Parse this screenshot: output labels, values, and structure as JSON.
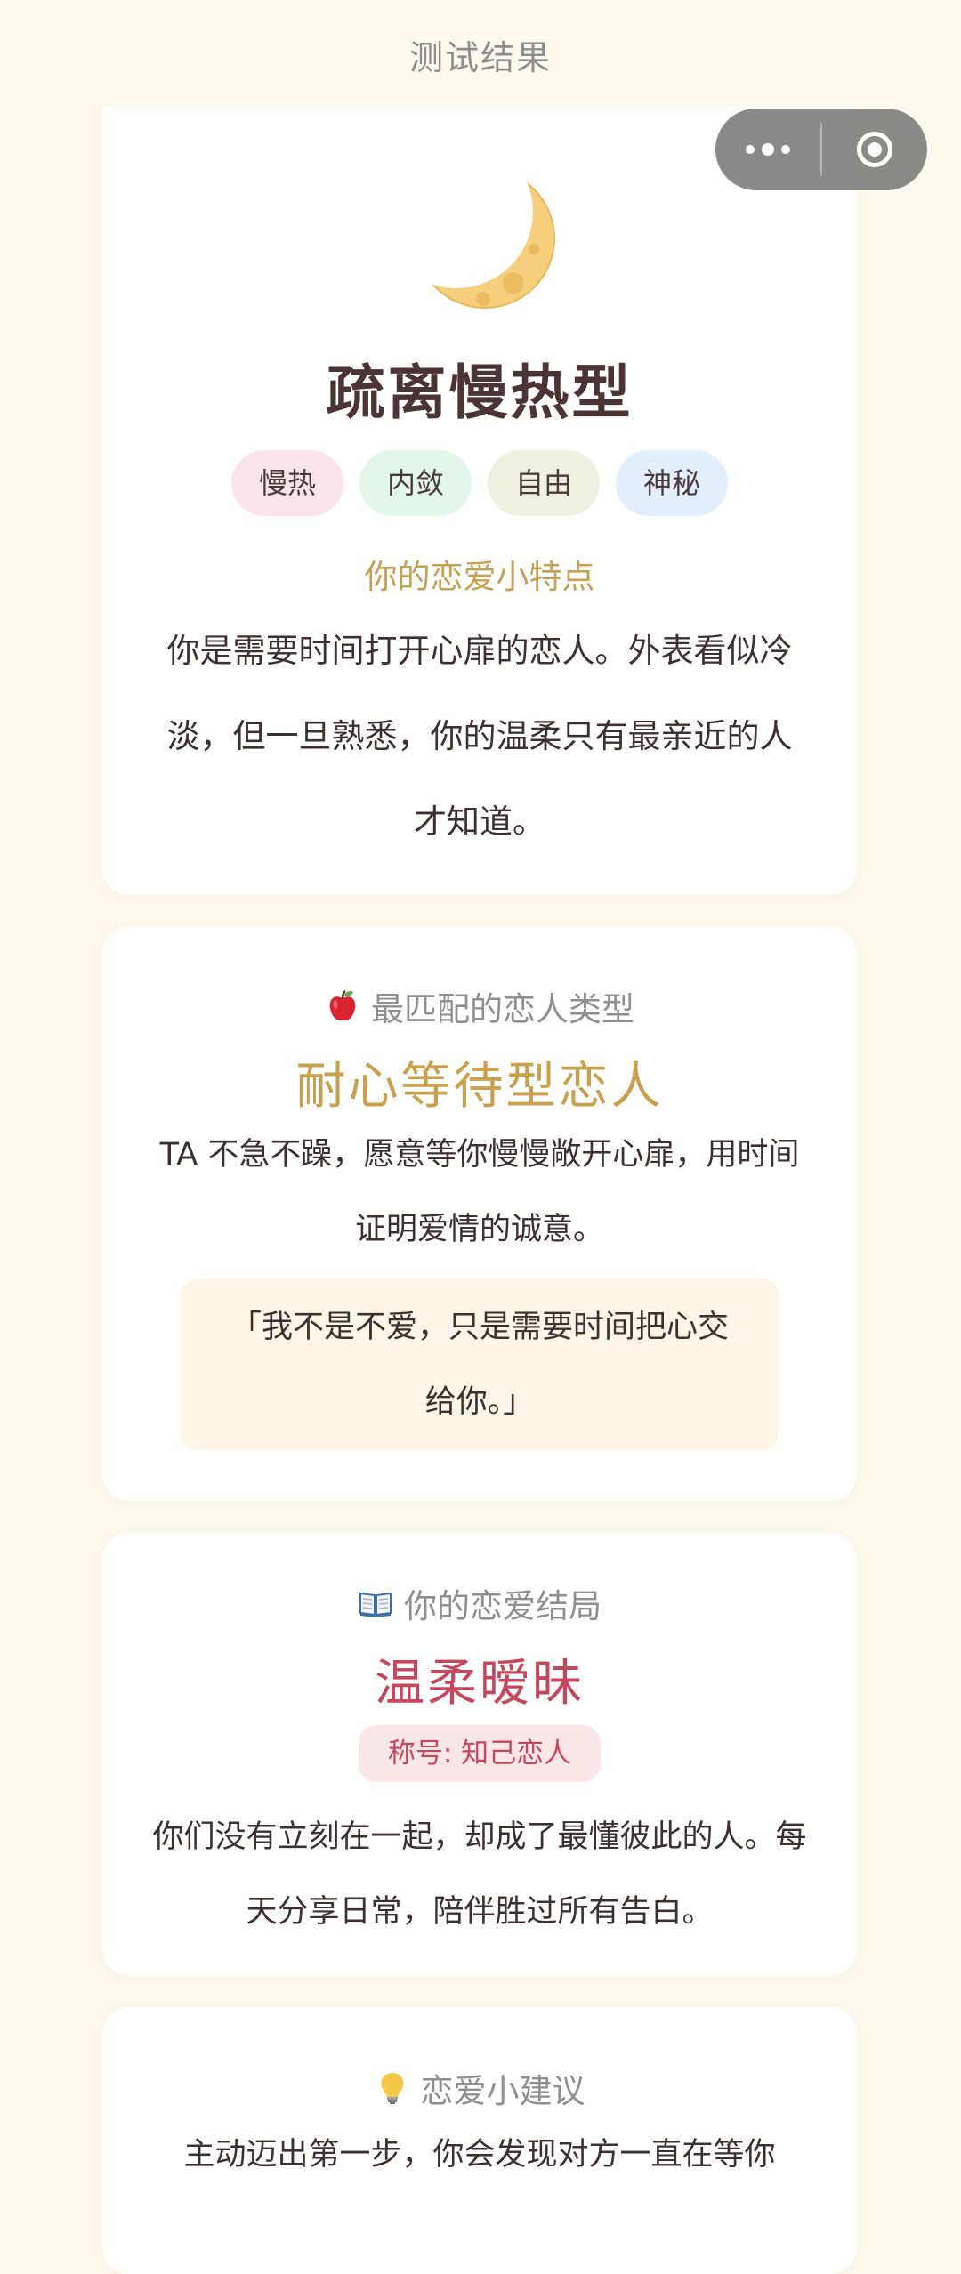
{
  "header": {
    "title": "测试结果"
  },
  "capsule": {
    "more_icon": "more-dots-icon",
    "close_icon": "mini-program-close-icon",
    "background": "#808080"
  },
  "result": {
    "icon": "crescent-moon-icon",
    "title": "疏离慢热型",
    "tags": [
      {
        "label": "慢热",
        "color": "#fbe4ec"
      },
      {
        "label": "内敛",
        "color": "#e2f6ec"
      },
      {
        "label": "自由",
        "color": "#eef0e2"
      },
      {
        "label": "神秘",
        "color": "#e4effe"
      }
    ],
    "traits_heading": "你的恋爱小特点",
    "traits_text": "你是需要时间打开心扉的恋人。外表看似冷淡，但一旦熟悉，你的温柔只有最亲近的人才知道。"
  },
  "match": {
    "icon": "apple-icon",
    "heading": "最匹配的恋人类型",
    "type": "耐心等待型恋人",
    "description": "TA 不急不躁，愿意等你慢慢敞开心扉，用时间证明爱情的诚意。",
    "quote": "「我不是不爱，只是需要时间把心交给你。」"
  },
  "ending": {
    "icon": "open-book-icon",
    "heading": "你的恋爱结局",
    "title": "温柔暧昧",
    "badge": "称号: 知己恋人",
    "description": "你们没有立刻在一起，却成了最懂彼此的人。每天分享日常，陪伴胜过所有告白。"
  },
  "advice": {
    "icon": "light-bulb-icon",
    "heading": "恋爱小建议",
    "text": "主动迈出第一步，你会发现对方一直在等你"
  },
  "colors": {
    "page_background": "#fdf9ee",
    "gold": "#c9a14d",
    "rose": "#c6475c"
  }
}
